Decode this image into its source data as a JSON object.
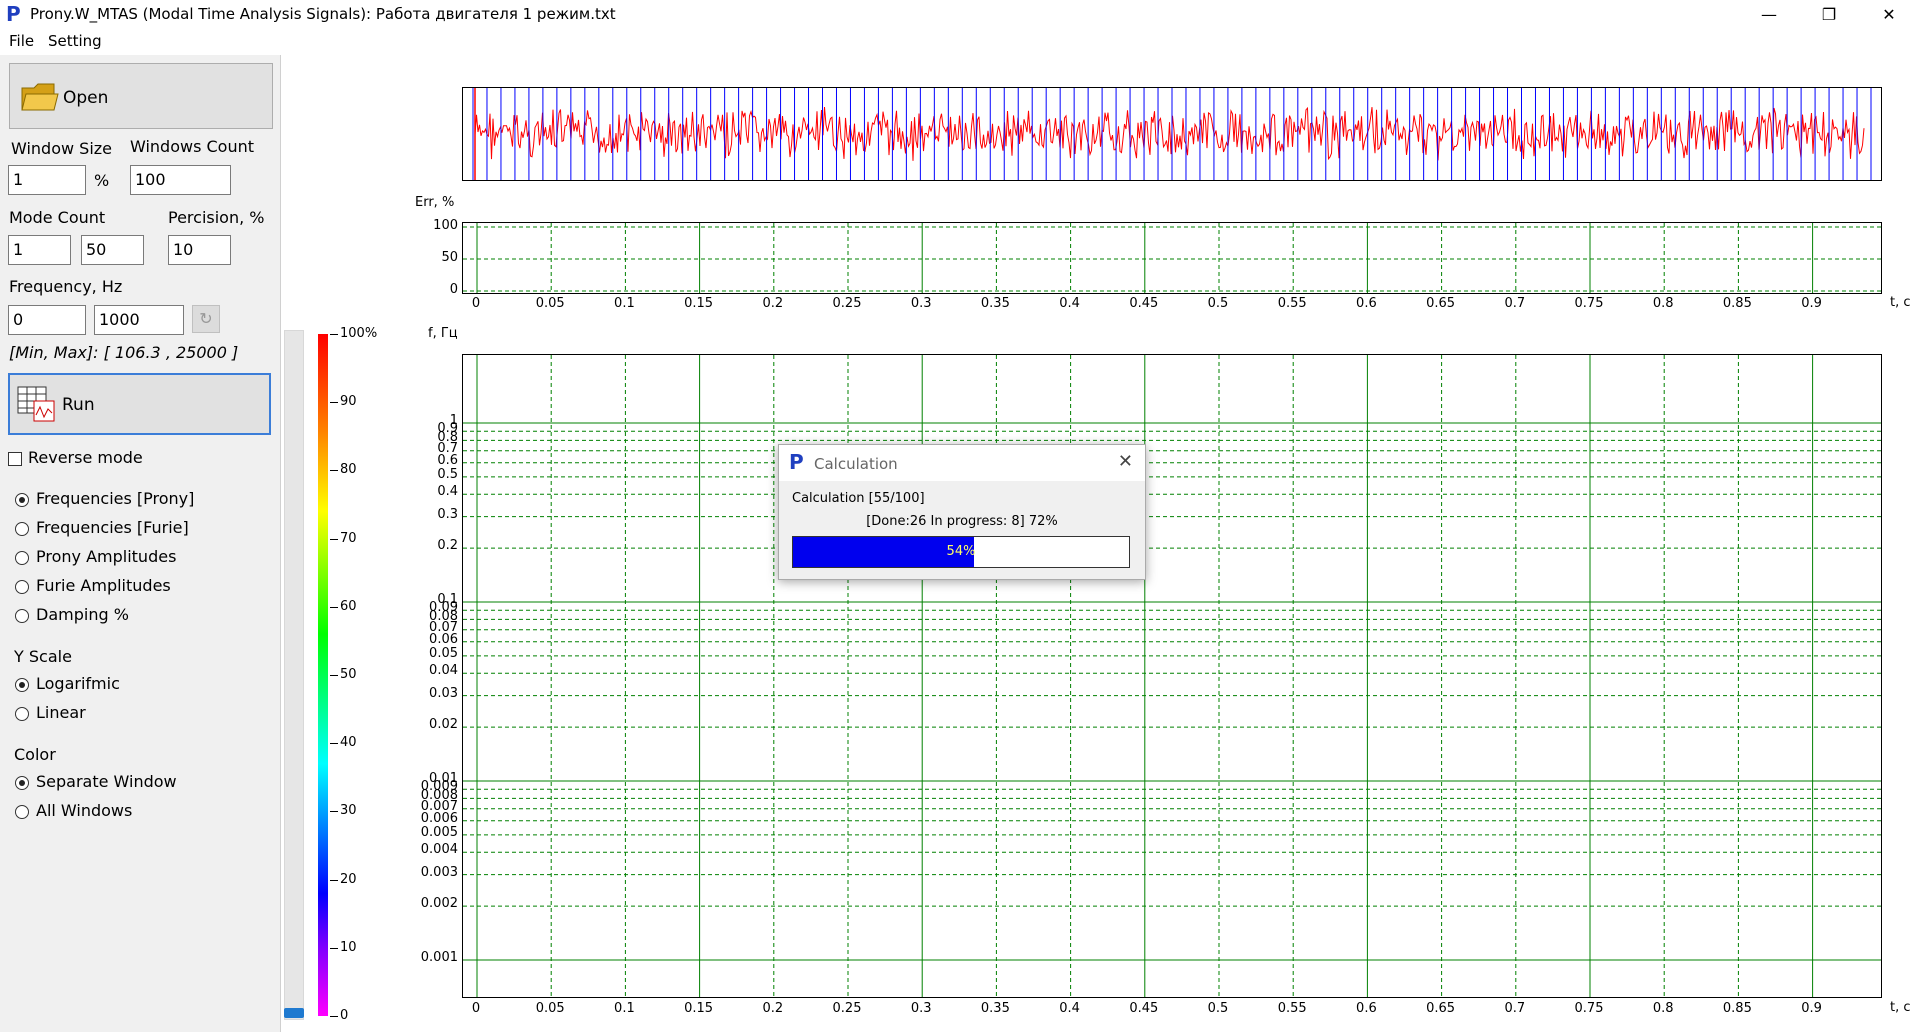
{
  "window": {
    "app_icon": "P",
    "title": "Prony.W_MTAS (Modal Time Analysis Signals): Работа двигателя 1 режим.txt",
    "minimize_glyph": "—",
    "maximize_glyph": "❐",
    "close_glyph": "✕"
  },
  "menu": {
    "file": "File",
    "setting": "Setting"
  },
  "left": {
    "open_label": "Open",
    "window_size_label": "Window Size",
    "window_size_value": "1",
    "window_size_unit": "%",
    "windows_count_label": "Windows Count",
    "windows_count_value": "100",
    "mode_count_label": "Mode Count",
    "mode_count_min": "1",
    "mode_count_max": "50",
    "percision_label": "Percision, %",
    "percision_value": "10",
    "frequency_label": "Frequency, Hz",
    "frequency_min": "0",
    "frequency_max": "1000",
    "minmax_text": "[Min, Max]: [ 106.3 , 25000 ]",
    "run_label": "Run",
    "reverse_mode_label": "Reverse mode",
    "reverse_mode_checked": false,
    "plot_modes": [
      {
        "label": "Frequencies [Prony]",
        "selected": true
      },
      {
        "label": "Frequencies [Furie]",
        "selected": false
      },
      {
        "label": "Prony Amplitudes",
        "selected": false
      },
      {
        "label": "Furie Amplitudes",
        "selected": false
      },
      {
        "label": "Damping %",
        "selected": false
      }
    ],
    "yscale_title": "Y Scale",
    "yscale_options": [
      {
        "label": "Logarifmic",
        "selected": true
      },
      {
        "label": "Linear",
        "selected": false
      }
    ],
    "color_title": "Color",
    "color_options": [
      {
        "label": "Separate Window",
        "selected": true
      },
      {
        "label": "All Windows",
        "selected": false
      }
    ]
  },
  "colorbar": {
    "labels": [
      "100%",
      "90",
      "80",
      "70",
      "60",
      "50",
      "40",
      "30",
      "20",
      "10",
      "0"
    ],
    "slider_level": 0.0
  },
  "signal_plot": {
    "trace_color": "#ff0000",
    "window_line_color": "#0000ff",
    "window_count": 100
  },
  "err_plot": {
    "ylabel": "Err, %",
    "xlabel": "t, c",
    "yticks": [
      "100",
      "50",
      "0"
    ],
    "xticks": [
      "0",
      "0.05",
      "0.1",
      "0.15",
      "0.2",
      "0.25",
      "0.3",
      "0.35",
      "0.4",
      "0.45",
      "0.5",
      "0.55",
      "0.6",
      "0.65",
      "0.7",
      "0.75",
      "0.8",
      "0.85",
      "0.9"
    ]
  },
  "freq_plot": {
    "ylabel": "f, Гц",
    "xlabel": "t, c",
    "yticks": [
      "1",
      "0.9",
      "0.8",
      "0.7",
      "0.6",
      "0.5",
      "0.4",
      "0.3",
      "0.2",
      "0.1",
      "0.09",
      "0.08",
      "0.07",
      "0.06",
      "0.05",
      "0.04",
      "0.03",
      "0.02",
      "0.01",
      "0.009",
      "0.008",
      "0.007",
      "0.006",
      "0.005",
      "0.004",
      "0.003",
      "0.002",
      "0.001"
    ],
    "xticks": [
      "0",
      "0.05",
      "0.1",
      "0.15",
      "0.2",
      "0.25",
      "0.3",
      "0.35",
      "0.4",
      "0.45",
      "0.5",
      "0.55",
      "0.6",
      "0.65",
      "0.7",
      "0.75",
      "0.8",
      "0.85",
      "0.9"
    ],
    "grid_color": "#008000"
  },
  "dialog": {
    "icon": "P",
    "title": "Calculation",
    "close_glyph": "✕",
    "line1": "Calculation [55/100]",
    "line2": "[Done:26 In progress: 8] 72%",
    "progress_text": "54%",
    "progress": 0.54
  }
}
